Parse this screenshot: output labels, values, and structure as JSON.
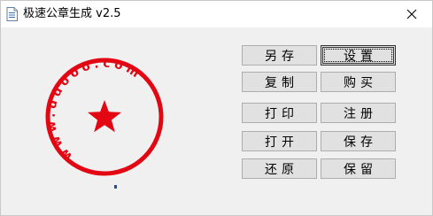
{
  "window": {
    "title": "极速公章生成 v2.5",
    "icons": {
      "app": "document-icon",
      "close": "close-icon"
    }
  },
  "seal": {
    "ring_text": "www.ddooo.com",
    "center_symbol": "star-icon",
    "color": "#e30613"
  },
  "buttons": {
    "save_as": "另存",
    "settings": "设置",
    "copy": "复制",
    "buy": "购买",
    "print": "打印",
    "register": "注册",
    "open": "打开",
    "save": "保存",
    "restore": "还原",
    "keep": "保留"
  }
}
